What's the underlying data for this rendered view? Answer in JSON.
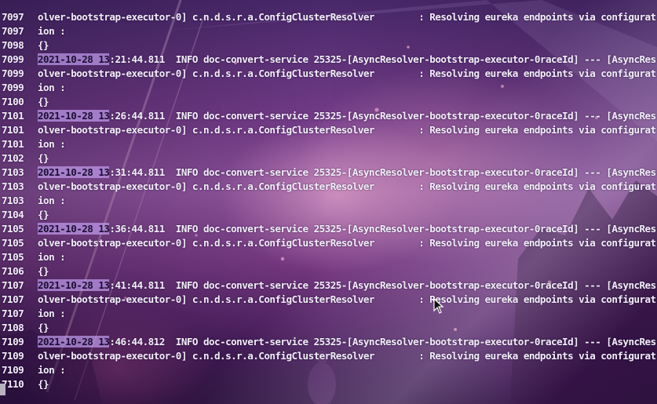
{
  "terminal": {
    "highlight_color": "#c39ff0",
    "text_color": "#f2eef8",
    "lines": [
      {
        "n": "7097",
        "hl": "",
        "text": "olver-bootstrap-executor-0] c.n.d.s.r.a.ConfigClusterResolver        : Resolving eureka endpoints via configurat"
      },
      {
        "n": "7097",
        "hl": "",
        "text": "ion :"
      },
      {
        "n": "7098",
        "hl": "",
        "text": "{}"
      },
      {
        "n": "7099",
        "hl": "2021-10-28 13",
        "text": ":21:44.811  INFO doc-convert-service 25325-[AsyncResolver-bootstrap-executor-0raceId] --- [AsyncRes"
      },
      {
        "n": "7099",
        "hl": "",
        "text": "olver-bootstrap-executor-0] c.n.d.s.r.a.ConfigClusterResolver        : Resolving eureka endpoints via configurat"
      },
      {
        "n": "7099",
        "hl": "",
        "text": "ion :"
      },
      {
        "n": "7100",
        "hl": "",
        "text": "{}"
      },
      {
        "n": "7101",
        "hl": "2021-10-28 13",
        "text": ":26:44.811  INFO doc-convert-service 25325-[AsyncResolver-bootstrap-executor-0raceId] --- [AsyncRes"
      },
      {
        "n": "7101",
        "hl": "",
        "text": "olver-bootstrap-executor-0] c.n.d.s.r.a.ConfigClusterResolver        : Resolving eureka endpoints via configurat"
      },
      {
        "n": "7101",
        "hl": "",
        "text": "ion :"
      },
      {
        "n": "7102",
        "hl": "",
        "text": "{}"
      },
      {
        "n": "7103",
        "hl": "2021-10-28 13",
        "text": ":31:44.811  INFO doc-convert-service 25325-[AsyncResolver-bootstrap-executor-0raceId] --- [AsyncRes"
      },
      {
        "n": "7103",
        "hl": "",
        "text": "olver-bootstrap-executor-0] c.n.d.s.r.a.ConfigClusterResolver        : Resolving eureka endpoints via configurat"
      },
      {
        "n": "7103",
        "hl": "",
        "text": "ion :"
      },
      {
        "n": "7104",
        "hl": "",
        "text": "{}"
      },
      {
        "n": "7105",
        "hl": "2021-10-28 13",
        "text": ":36:44.811  INFO doc-convert-service 25325-[AsyncResolver-bootstrap-executor-0raceId] --- [AsyncRes"
      },
      {
        "n": "7105",
        "hl": "",
        "text": "olver-bootstrap-executor-0] c.n.d.s.r.a.ConfigClusterResolver        : Resolving eureka endpoints via configurat"
      },
      {
        "n": "7105",
        "hl": "",
        "text": "ion :"
      },
      {
        "n": "7106",
        "hl": "",
        "text": "{}"
      },
      {
        "n": "7107",
        "hl": "2021-10-28 13",
        "text": ":41:44.811  INFO doc-convert-service 25325-[AsyncResolver-bootstrap-executor-0raceId] --- [AsyncRes"
      },
      {
        "n": "7107",
        "hl": "",
        "text": "olver-bootstrap-executor-0] c.n.d.s.r.a.ConfigClusterResolver        : Resolving eureka endpoints via configurat"
      },
      {
        "n": "7107",
        "hl": "",
        "text": "ion :"
      },
      {
        "n": "7108",
        "hl": "",
        "text": "{}"
      },
      {
        "n": "7109",
        "hl": "2021-10-28 13",
        "text": ":46:44.812  INFO doc-convert-service 25325-[AsyncResolver-bootstrap-executor-0raceId] --- [AsyncRes"
      },
      {
        "n": "7109",
        "hl": "",
        "text": "olver-bootstrap-executor-0] c.n.d.s.r.a.ConfigClusterResolver        : Resolving eureka endpoints via configurat"
      },
      {
        "n": "7109",
        "hl": "",
        "text": "ion :"
      },
      {
        "n": "7110",
        "hl": "",
        "text": "{}"
      }
    ]
  }
}
